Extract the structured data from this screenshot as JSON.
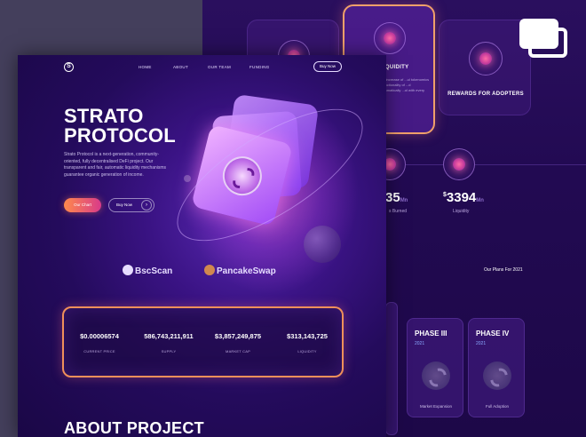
{
  "nav": {
    "logo": "S",
    "links": [
      "HOME",
      "ABOUT",
      "OUR TEAM",
      "FUNDING"
    ],
    "buy_now": "Buy Now"
  },
  "hero": {
    "title_line1": "STRATO",
    "title_line2": "PROTOCOL",
    "description": "Strato Protocol is a next-generation, community-oriented, fully decentralised DeFi project. Our transparent and fair, automatic liquidity mechanisms guarantee organic generation of income.",
    "chart_button": "Our Chart",
    "buy_button": "Buy Now",
    "buy_arrow": "›"
  },
  "partners": [
    "BscScan",
    "PancakeSwap"
  ],
  "stats": [
    {
      "value": "$0.00006574",
      "label": "CURRENT PRICE"
    },
    {
      "value": "586,743,211,911",
      "label": "SUPPLY"
    },
    {
      "value": "$3,857,249,875",
      "label": "MARKET CAP"
    },
    {
      "value": "$313,143,725",
      "label": "LIQUIDITY"
    }
  ],
  "about": {
    "title": "ABOUT PROJECT"
  },
  "back": {
    "liquidity_title": "LIQUIDITY",
    "liquidity_desc": "...e increase of ...ul tokenomics ...unctionality of ...d automatically ...ol with every",
    "rewards_title": "REWARDS FOR ADOPTERS",
    "stat1": {
      "value": "35",
      "suffix": "Mn",
      "label": "s Burned"
    },
    "stat2": {
      "prefix": "$",
      "value": "3394",
      "suffix": "Mn",
      "label": "Liquidity"
    },
    "plans_title": "Our Plans For 2021",
    "phases": [
      {
        "title": "PHASE III",
        "year": "2021",
        "desc": "Market  Expansion"
      },
      {
        "title": "PHASE IV",
        "year": "2021",
        "desc": "Full Adoption"
      }
    ]
  },
  "colors": {
    "accent_orange": "#f0905a",
    "accent_pink": "#d83a8a",
    "bg_purple": "#240b5c"
  },
  "icons": {
    "top_right": "gallery-icon"
  }
}
